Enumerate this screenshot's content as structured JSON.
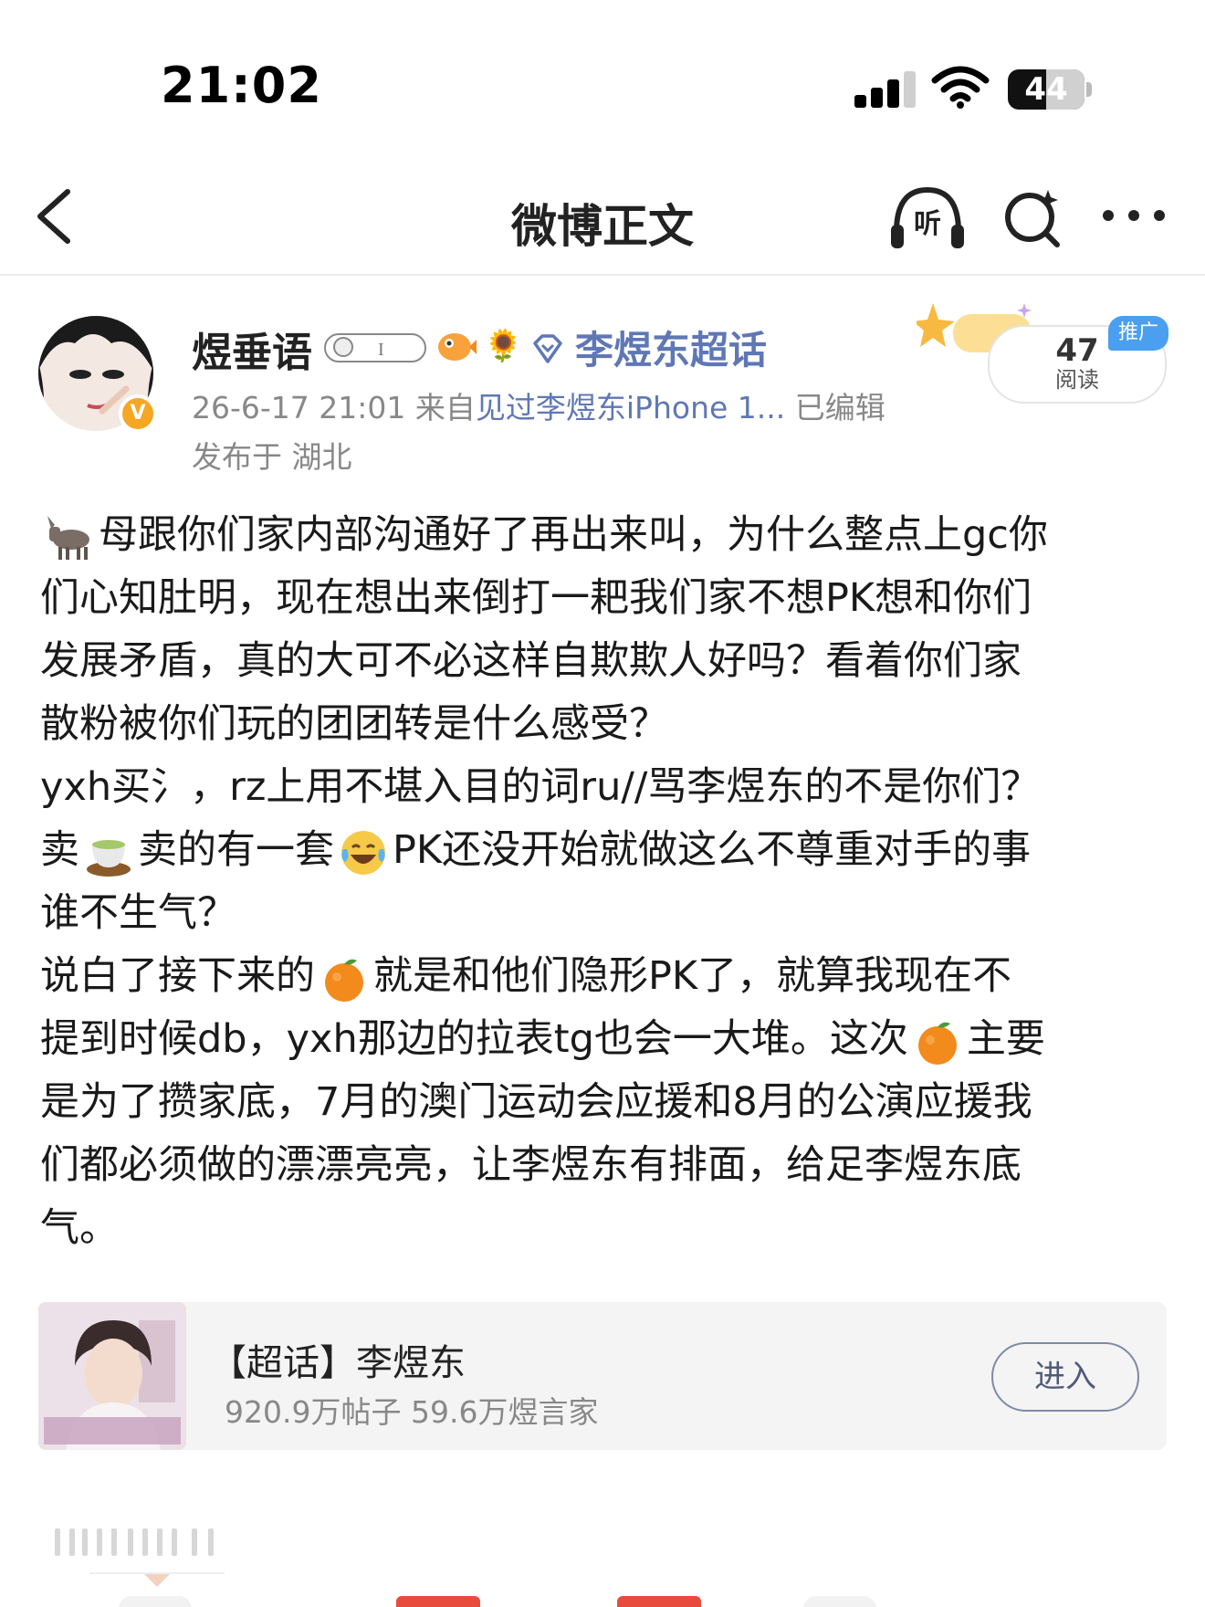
{
  "status_bar": {
    "time": "21:02",
    "battery_level": "44"
  },
  "nav": {
    "title": "微博正文",
    "listen_label": "听"
  },
  "post": {
    "author": "煜垂语",
    "supertopic_link": "李煜东超话",
    "meta_date": "26-6-17 21:01",
    "meta_from": "来自",
    "meta_source": "见过李煜东iPhone 1...",
    "meta_edited": "已编辑",
    "location": "发布于 湖北",
    "read_count": "47",
    "read_label": "阅读",
    "ad_tag": "推广",
    "body_lines": [
      "母跟你们家内部沟通好了再出来叫，为什么整点上gc你",
      "们心知肚明，现在想出来倒打一耙我们家不想PK想和你们",
      "发展矛盾，真的大可不必这样自欺欺人好吗？看着你们家",
      "散粉被你们玩的团团转是什么感受？",
      "yxh买氵，rz上用不堪入目的词ru//骂李煜东的不是你们？",
      "卖",
      "卖的有一套",
      "PK还没开始就做这么不尊重对手的事",
      "谁不生气？",
      "说白了接下来的",
      "就是和他们隐形PK了，就算我现在不",
      "提到时候db，yxh那边的拉表tg也会一大堆。这次",
      "主要",
      "是为了攒家底，7月的澳门运动会应援和8月的公演应援我",
      "们都必须做的漂漂亮亮，让李煜东有排面，给足李煜东底",
      "气。"
    ]
  },
  "topic_card": {
    "name": "【超话】李煜东",
    "stats": "920.9万帖子 59.6万煜言家",
    "enter_label": "进入"
  },
  "icons": {
    "back": "chevron-left-icon",
    "listen": "headphones-icon",
    "search": "search-sparkle-icon",
    "more": "more-dots-icon",
    "donkey": "donkey-emoji",
    "tea": "tea-emoji",
    "laugh_cry": "laugh-cry-emoji",
    "orange": "orange-emoji"
  },
  "colors": {
    "link_blue": "#5f77b5",
    "meta_grey": "#888888",
    "ad_blue": "#4a9ff0",
    "badge_orange": "#f5a623"
  }
}
